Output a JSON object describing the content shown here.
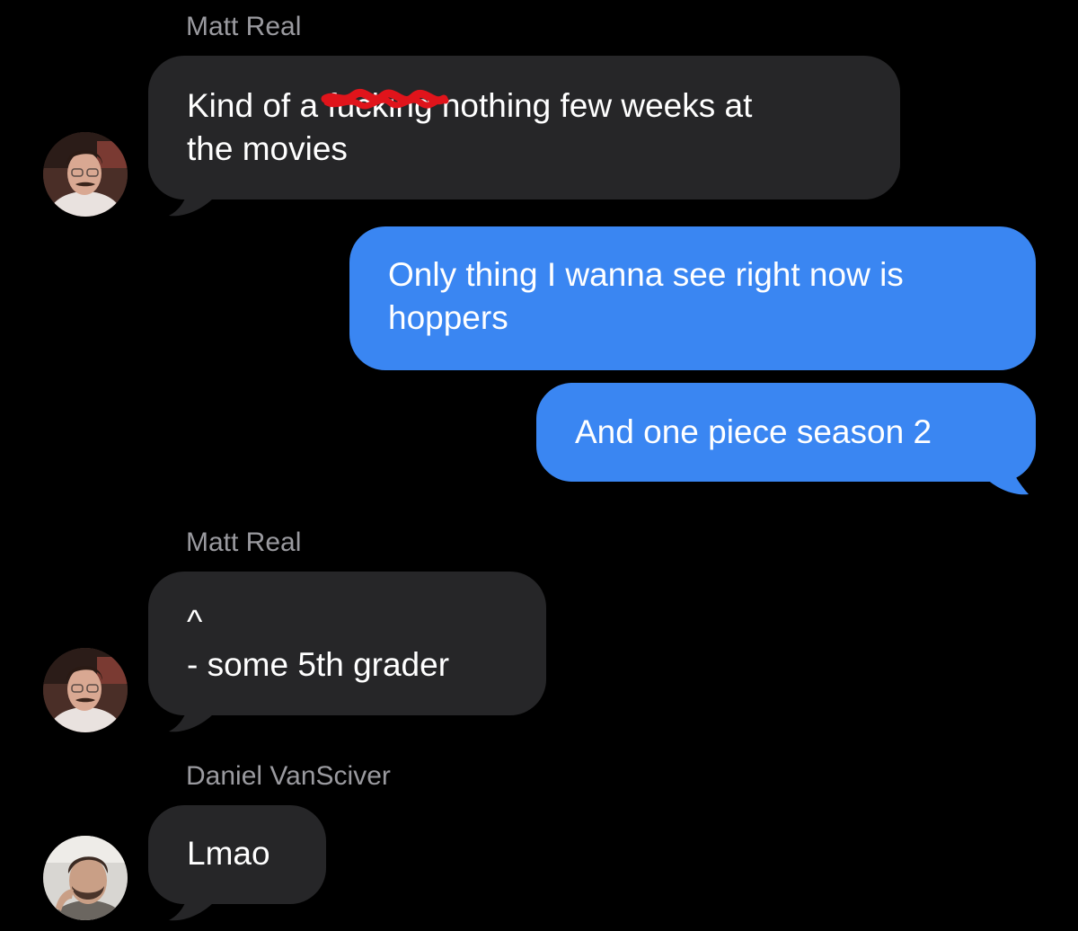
{
  "conversation": {
    "groups": [
      {
        "sender": "Matt Real",
        "messages": [
          {
            "pre": "Kind of a ",
            "redacted": "fucking",
            "post": " nothing few weeks at",
            "line2": "the movies"
          }
        ]
      },
      {
        "sender": "me",
        "messages": [
          {
            "line1": "Only thing I wanna see right now is",
            "line2": "hoppers"
          },
          {
            "line1": "And one piece season 2"
          }
        ]
      },
      {
        "sender": "Matt Real",
        "messages": [
          {
            "line1": "^",
            "line2": "- some 5th grader"
          }
        ]
      },
      {
        "sender": "Daniel VanSciver",
        "messages": [
          {
            "line1": "Lmao"
          }
        ]
      }
    ]
  },
  "colors": {
    "background": "#000000",
    "incoming_bubble": "#262628",
    "outgoing_bubble": "#3a86f2",
    "sender_name": "#9a9a9f",
    "redaction_scribble": "#e0141b"
  },
  "icons": {
    "matt_avatar": "profile-photo-man-glasses-mustache",
    "daniel_avatar": "profile-photo-man-beard"
  }
}
